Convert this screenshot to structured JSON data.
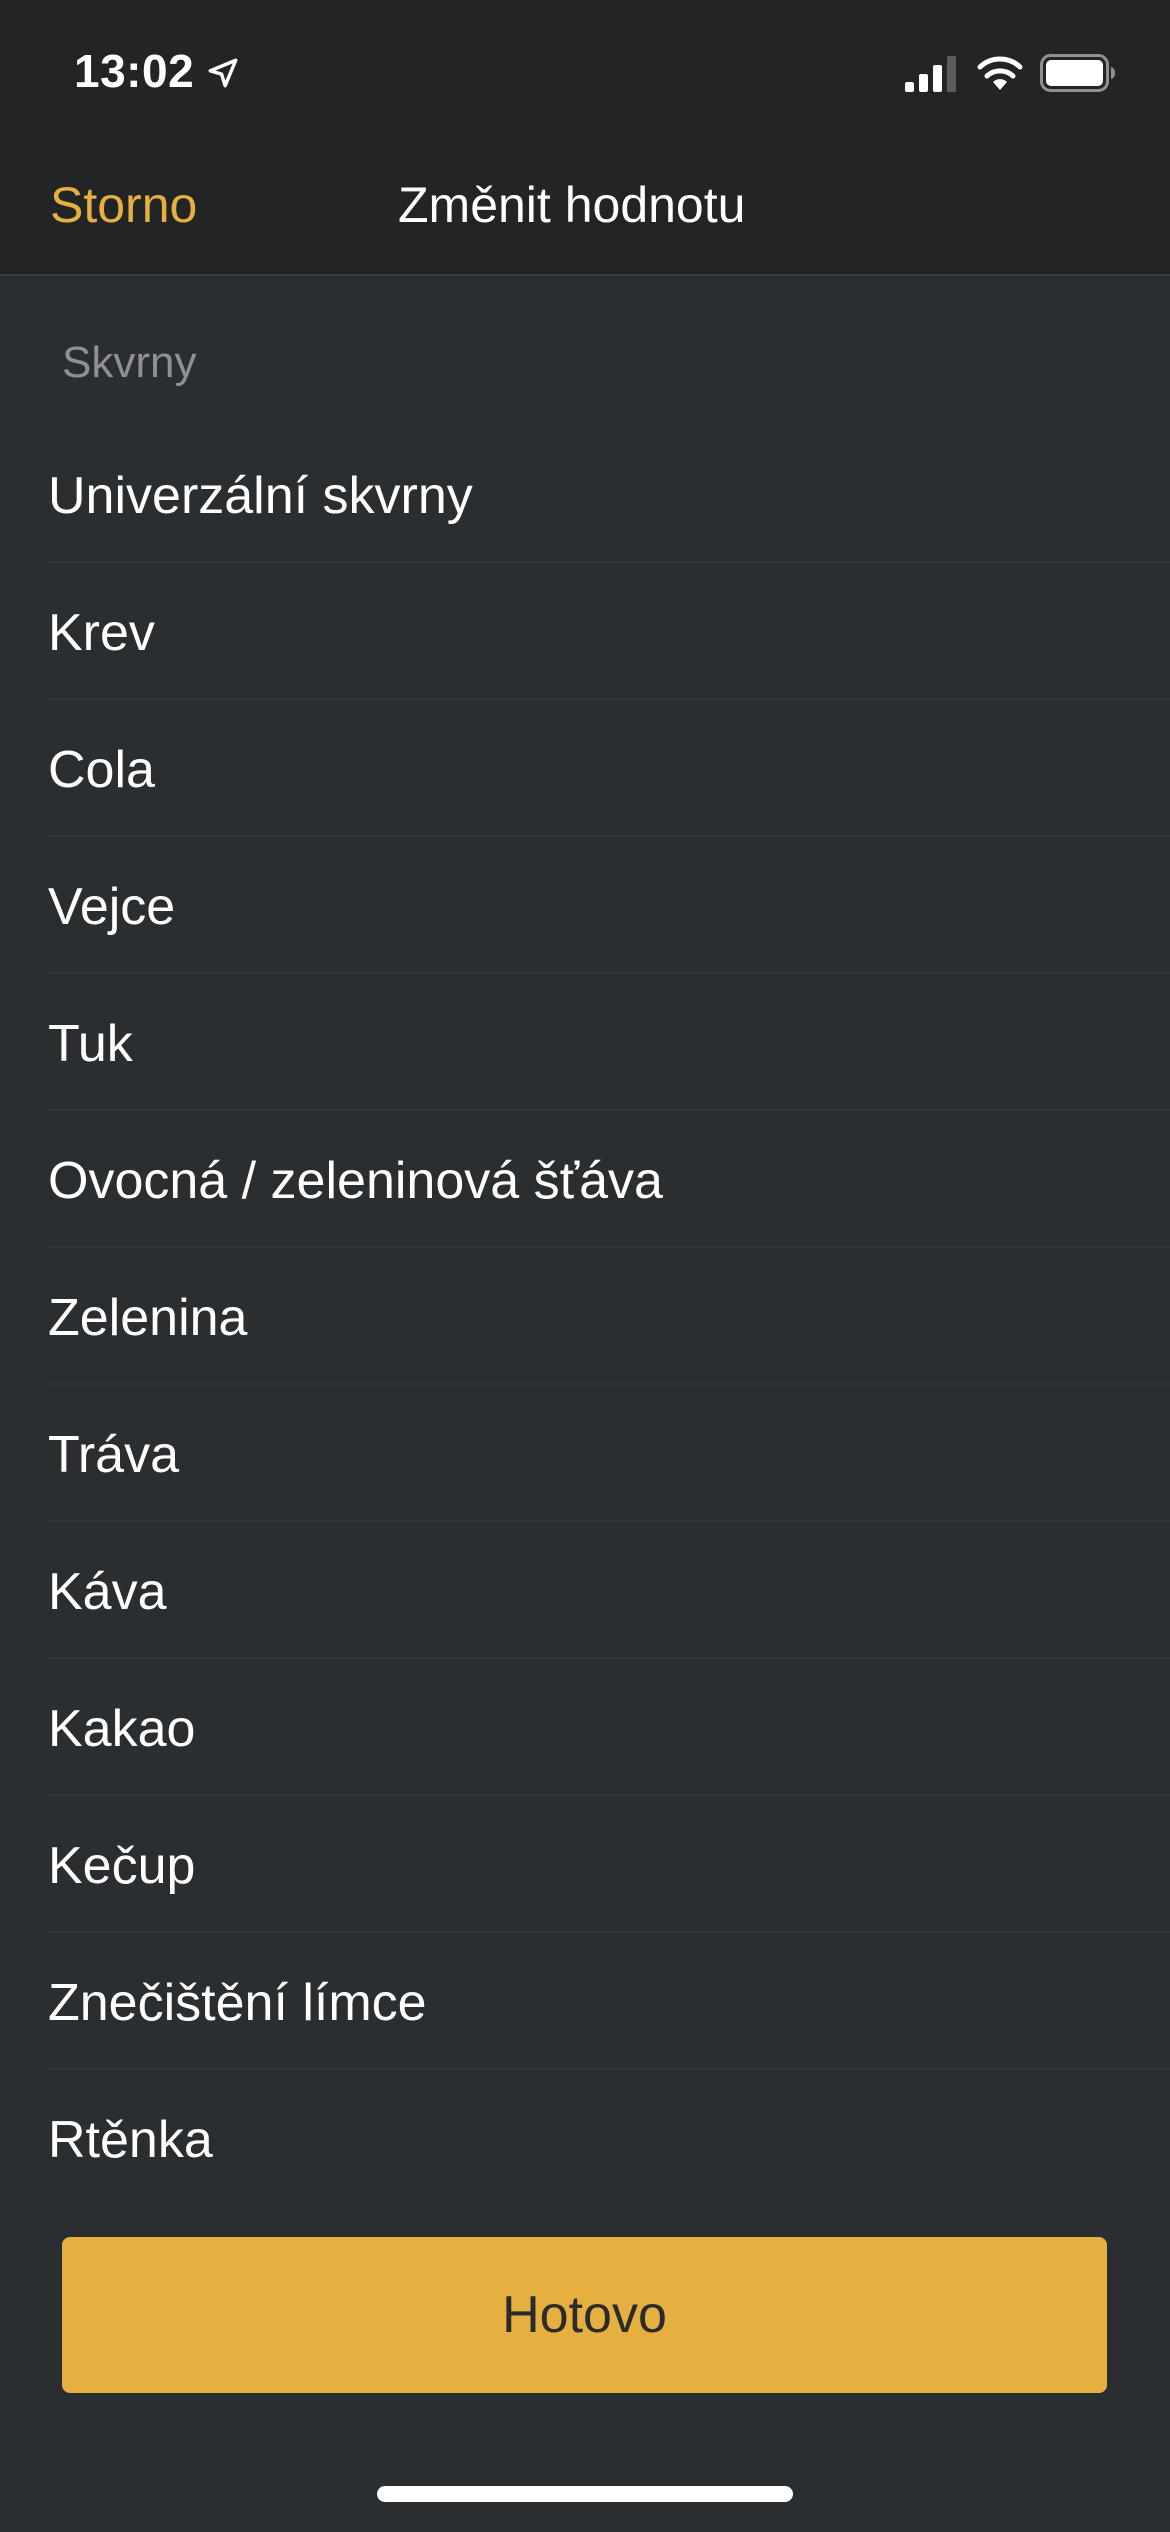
{
  "status_bar": {
    "time": "13:02",
    "icons": [
      "location-arrow-icon",
      "cellular-signal-icon",
      "wifi-icon",
      "battery-icon"
    ]
  },
  "nav": {
    "cancel_label": "Storno",
    "title": "Změnit hodnotu"
  },
  "section": {
    "header": "Skvrny"
  },
  "items": [
    "Univerzální skvrny",
    "Krev",
    "Cola",
    "Vejce",
    "Tuk",
    "Ovocná / zeleninová šťáva",
    "Zelenina",
    "Tráva",
    "Káva",
    "Kakao",
    "Kečup",
    "Znečištění límce",
    "Rtěnka"
  ],
  "done_label": "Hotovo",
  "colors": {
    "accent": "#e6b040",
    "background": "#2b2e30",
    "bar_background": "#232426"
  }
}
